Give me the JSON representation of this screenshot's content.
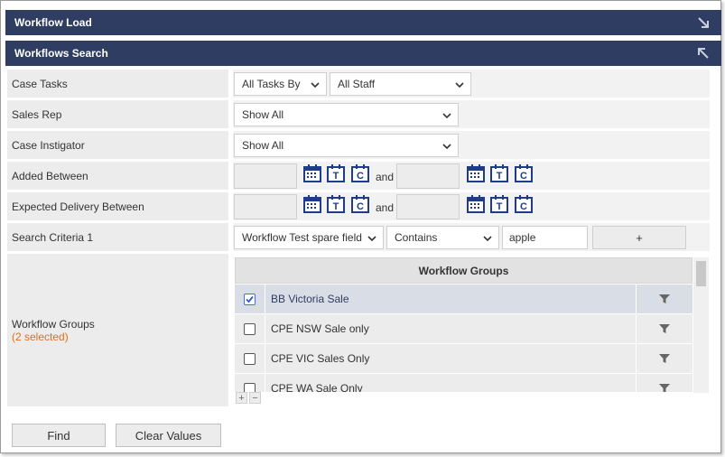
{
  "panels": {
    "workflow_load": "Workflow Load",
    "workflows_search": "Workflows Search"
  },
  "fields": {
    "case_tasks": {
      "label": "Case Tasks",
      "select1": "All Tasks By",
      "select2": "All Staff"
    },
    "sales_rep": {
      "label": "Sales Rep",
      "select": "Show All"
    },
    "case_instigator": {
      "label": "Case Instigator",
      "select": "Show All"
    },
    "added_between": {
      "label": "Added Between",
      "from": "",
      "to": "",
      "and": "and"
    },
    "expected_delivery": {
      "label": "Expected Delivery Between",
      "from": "",
      "to": "",
      "and": "and"
    },
    "search_criteria": {
      "label": "Search Criteria 1",
      "field": "Workflow Test spare field",
      "operator": "Contains",
      "value": "apple",
      "add": "+"
    },
    "workflow_groups": {
      "label": "Workflow Groups",
      "selected": "(2 selected)"
    }
  },
  "date_buttons": {
    "calendar": "calendar-icon",
    "today": "T",
    "clear": "C"
  },
  "groups_grid": {
    "header": "Workflow Groups",
    "rows": [
      {
        "name": "BB Victoria Sale",
        "checked": true
      },
      {
        "name": "CPE NSW Sale only",
        "checked": false
      },
      {
        "name": "CPE VIC Sales Only",
        "checked": false
      },
      {
        "name": "CPE WA Sale Only",
        "checked": false
      }
    ],
    "expand": "+",
    "collapse": "−"
  },
  "actions": {
    "find": "Find",
    "clear": "Clear Values"
  },
  "colors": {
    "header_bg": "#2e3d61",
    "accent": "#2e3d61",
    "selected_count": "#e07020",
    "icon_blue": "#1f3c88"
  }
}
